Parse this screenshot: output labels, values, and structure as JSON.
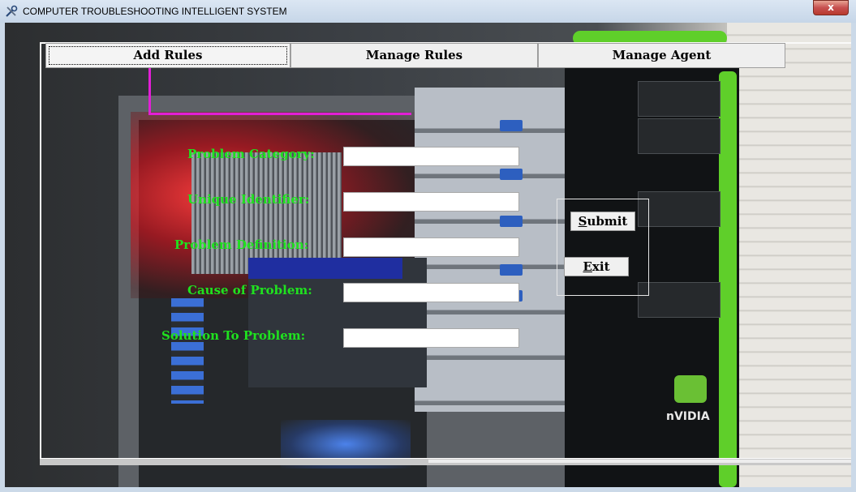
{
  "window": {
    "title": "COMPUTER TROUBLESHOOTING INTELLIGENT SYSTEM",
    "app_icon": "tools-icon",
    "close_glyph": "x"
  },
  "tabs": [
    {
      "label": "Add Rules",
      "active": true
    },
    {
      "label": "Manage Rules",
      "active": false
    },
    {
      "label": "Manage Agent",
      "active": false
    }
  ],
  "form": {
    "fields": [
      {
        "label": "Problem Category:",
        "value": ""
      },
      {
        "label": "Unique Identifier:",
        "value": ""
      },
      {
        "label": "Problem Definition:",
        "value": ""
      },
      {
        "label": "Cause of Problem:",
        "value": ""
      },
      {
        "label": "Solution To Problem:",
        "value": ""
      }
    ],
    "submit": {
      "mnemonic": "S",
      "rest": "ubmit"
    },
    "exit": {
      "mnemonic": "E",
      "rest": "xit"
    }
  },
  "colors": {
    "label_text": "#1fe21f",
    "tab_indicator": "#e21fd6"
  },
  "background_photo_text": {
    "brand": "nVIDIA"
  }
}
